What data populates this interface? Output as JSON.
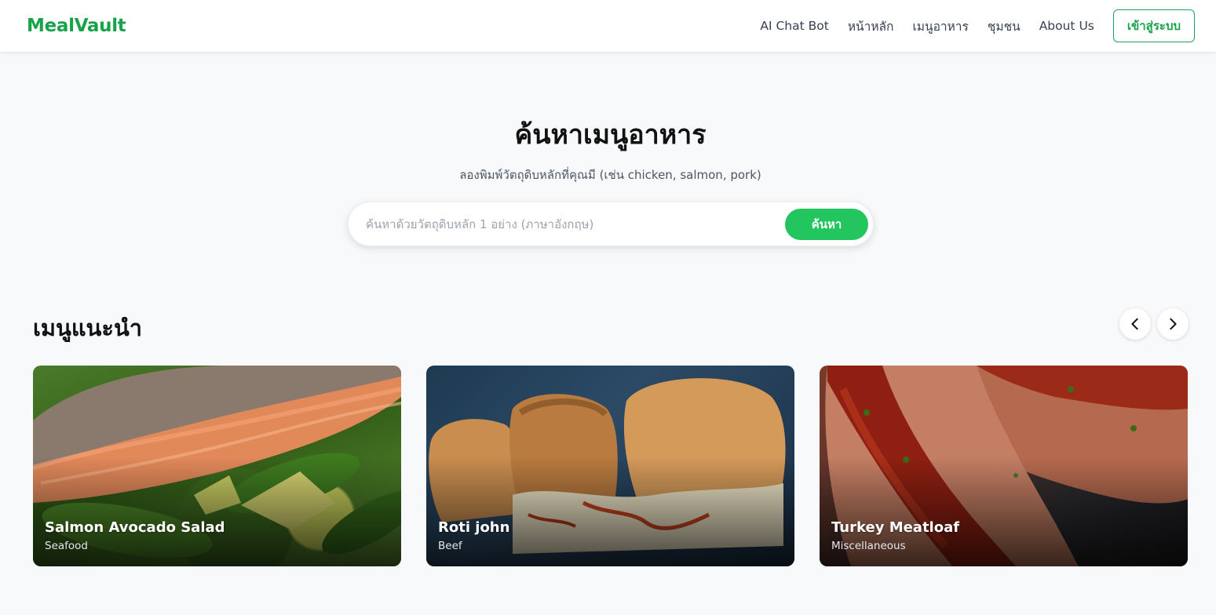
{
  "header": {
    "logo": "MealVault",
    "nav": [
      {
        "label": "AI Chat Bot"
      },
      {
        "label": "หน้าหลัก"
      },
      {
        "label": "เมนูอาหาร"
      },
      {
        "label": "ชุมชน"
      },
      {
        "label": "About Us"
      }
    ],
    "login_label": "เข้าสู่ระบบ"
  },
  "hero": {
    "title": "ค้นหาเมนูอาหาร",
    "subtitle": "ลองพิมพ์วัตถุดิบหลักที่คุณมี (เช่น chicken, salmon, pork)",
    "search_placeholder": "ค้นหาด้วยวัตถุดิบหลัก 1 อย่าง (ภาษาอังกฤษ)",
    "search_value": "",
    "search_button": "ค้นหา"
  },
  "recommended": {
    "title": "เมนูแนะนำ",
    "prev_icon": "chevron-left-icon",
    "next_icon": "chevron-right-icon",
    "cards": [
      {
        "name": "Salmon Avocado Salad",
        "category": "Seafood"
      },
      {
        "name": "Roti john",
        "category": "Beef"
      },
      {
        "name": "Turkey Meatloaf",
        "category": "Miscellaneous"
      }
    ]
  },
  "colors": {
    "brand": "#17a34a",
    "search_button": "#22c55e",
    "background": "#f8f9fb"
  }
}
